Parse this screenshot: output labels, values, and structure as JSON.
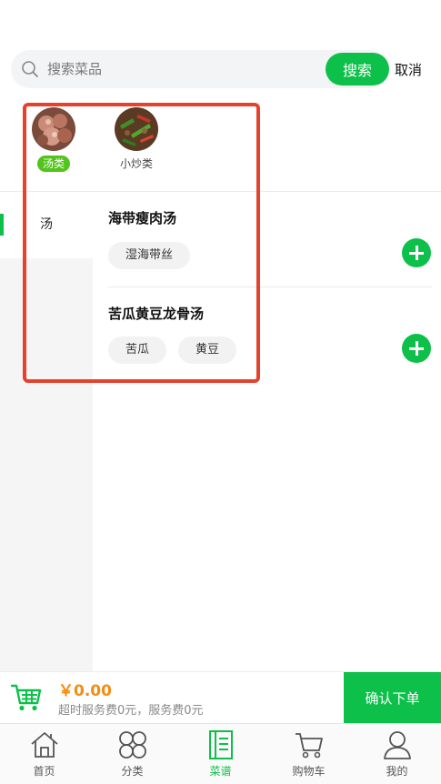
{
  "search": {
    "placeholder": "搜索菜品",
    "button_label": "搜索",
    "cancel_label": "取消"
  },
  "categories": [
    {
      "label": "汤类",
      "active": true,
      "image": "pork-soup-photo"
    },
    {
      "label": "小炒类",
      "active": false,
      "image": "stir-fry-photo"
    }
  ],
  "sidebar": {
    "items": [
      {
        "label": "汤",
        "active": true
      }
    ]
  },
  "dishes": [
    {
      "name": "海带瘦肉汤",
      "ingredients": [
        "湿海带丝"
      ]
    },
    {
      "name": "苦瓜黄豆龙骨汤",
      "ingredients": [
        "苦瓜",
        "黄豆"
      ]
    }
  ],
  "checkout": {
    "price": "￥0.00",
    "fee_text": "超时服务费0元，服务费0元",
    "confirm_label": "确认下单"
  },
  "bottom_nav": {
    "items": [
      {
        "label": "首页",
        "icon": "home-icon",
        "active": false
      },
      {
        "label": "分类",
        "icon": "category-icon",
        "active": false
      },
      {
        "label": "菜谱",
        "icon": "recipe-icon",
        "active": true
      },
      {
        "label": "购物车",
        "icon": "cart-icon",
        "active": false
      },
      {
        "label": "我的",
        "icon": "profile-icon",
        "active": false
      }
    ]
  },
  "colors": {
    "accent": "#0dc04a",
    "active_tag": "#52c41a",
    "price": "#f38c12",
    "highlight": "#e5412d"
  }
}
